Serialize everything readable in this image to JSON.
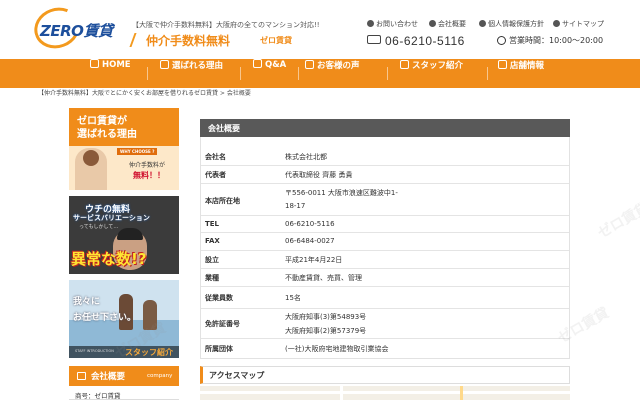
{
  "header": {
    "logo_text": "ZERO",
    "logo_kanji": "賃貸",
    "tagline": "【大阪で仲介手数料無料】大阪府の全てのマンション対応!!",
    "promo_main": "仲介手数料無料",
    "promo_sub": "ゼロ賃貸",
    "top_links": [
      {
        "label": "お問い合わせ"
      },
      {
        "label": "会社概要"
      },
      {
        "label": "個人情報保護方針"
      },
      {
        "label": "サイトマップ"
      }
    ],
    "phone": "06-6210-5116",
    "hours": "営業時間：10:00〜20:00"
  },
  "nav": {
    "items": [
      {
        "label": "HOME"
      },
      {
        "label": "選ばれる理由"
      },
      {
        "label": "Q&A"
      },
      {
        "label": "お客様の声"
      },
      {
        "label": "スタッフ紹介"
      },
      {
        "label": "店舗情報"
      }
    ]
  },
  "breadcrumb": {
    "link": "【仲介手数料無料】大阪でとにかく安くお部屋を借りれるゼロ賃貸",
    "sep": " > ",
    "current": "会社概要"
  },
  "banners": {
    "reason": {
      "line1": "ゼロ賃貸が",
      "line2": "選ばれる理由",
      "why": "WHY CHOOSE ?",
      "caption1": "仲介手数料が",
      "caption2": "無料！！"
    },
    "abnormal": {
      "line1": "ウチの無料",
      "line2": "サービスバリエーション",
      "line3": "ってもしかして…",
      "big": "異常な数!?"
    },
    "staff": {
      "line1": "我々に",
      "line2": "お任せ下さい。",
      "intro": "STAFF INTRODUCTION",
      "label": "スタッフ紹介"
    }
  },
  "sidebar": {
    "title": "会社概要",
    "title_en": "company",
    "menu_item": "商号：ゼロ賃貸"
  },
  "company": {
    "heading": "会社概要",
    "rows": [
      {
        "label": "会社名",
        "lines": [
          "株式会社北都"
        ]
      },
      {
        "label": "代表者",
        "lines": [
          "代表取締役 齊藤 勇貴"
        ]
      },
      {
        "label": "本店所在地",
        "lines": [
          "〒556-0011 大阪市浪速区難波中1-",
          "18-17"
        ]
      },
      {
        "label": "TEL",
        "lines": [
          "06-6210-5116"
        ]
      },
      {
        "label": "FAX",
        "lines": [
          "06-6484-0027"
        ]
      },
      {
        "label": "設立",
        "lines": [
          "平成21年4月22日"
        ]
      },
      {
        "label": "業種",
        "lines": [
          "不動産賃貸、売買、管理"
        ]
      },
      {
        "label": "従業員数",
        "lines": [
          "15名"
        ]
      },
      {
        "label": "免許証番号",
        "lines": [
          "大阪府知事(3)第54893号",
          "大阪府知事(2)第57379号"
        ]
      },
      {
        "label": "所属団体",
        "lines": [
          "(一社)大阪府宅地建物取引業協会"
        ]
      }
    ]
  },
  "access": {
    "heading": "アクセスマップ"
  },
  "watermark": "ゼロ賃貸",
  "colors": {
    "accent": "#f08c1a",
    "brand_blue": "#1d4f9c",
    "panel_head": "#595959"
  }
}
